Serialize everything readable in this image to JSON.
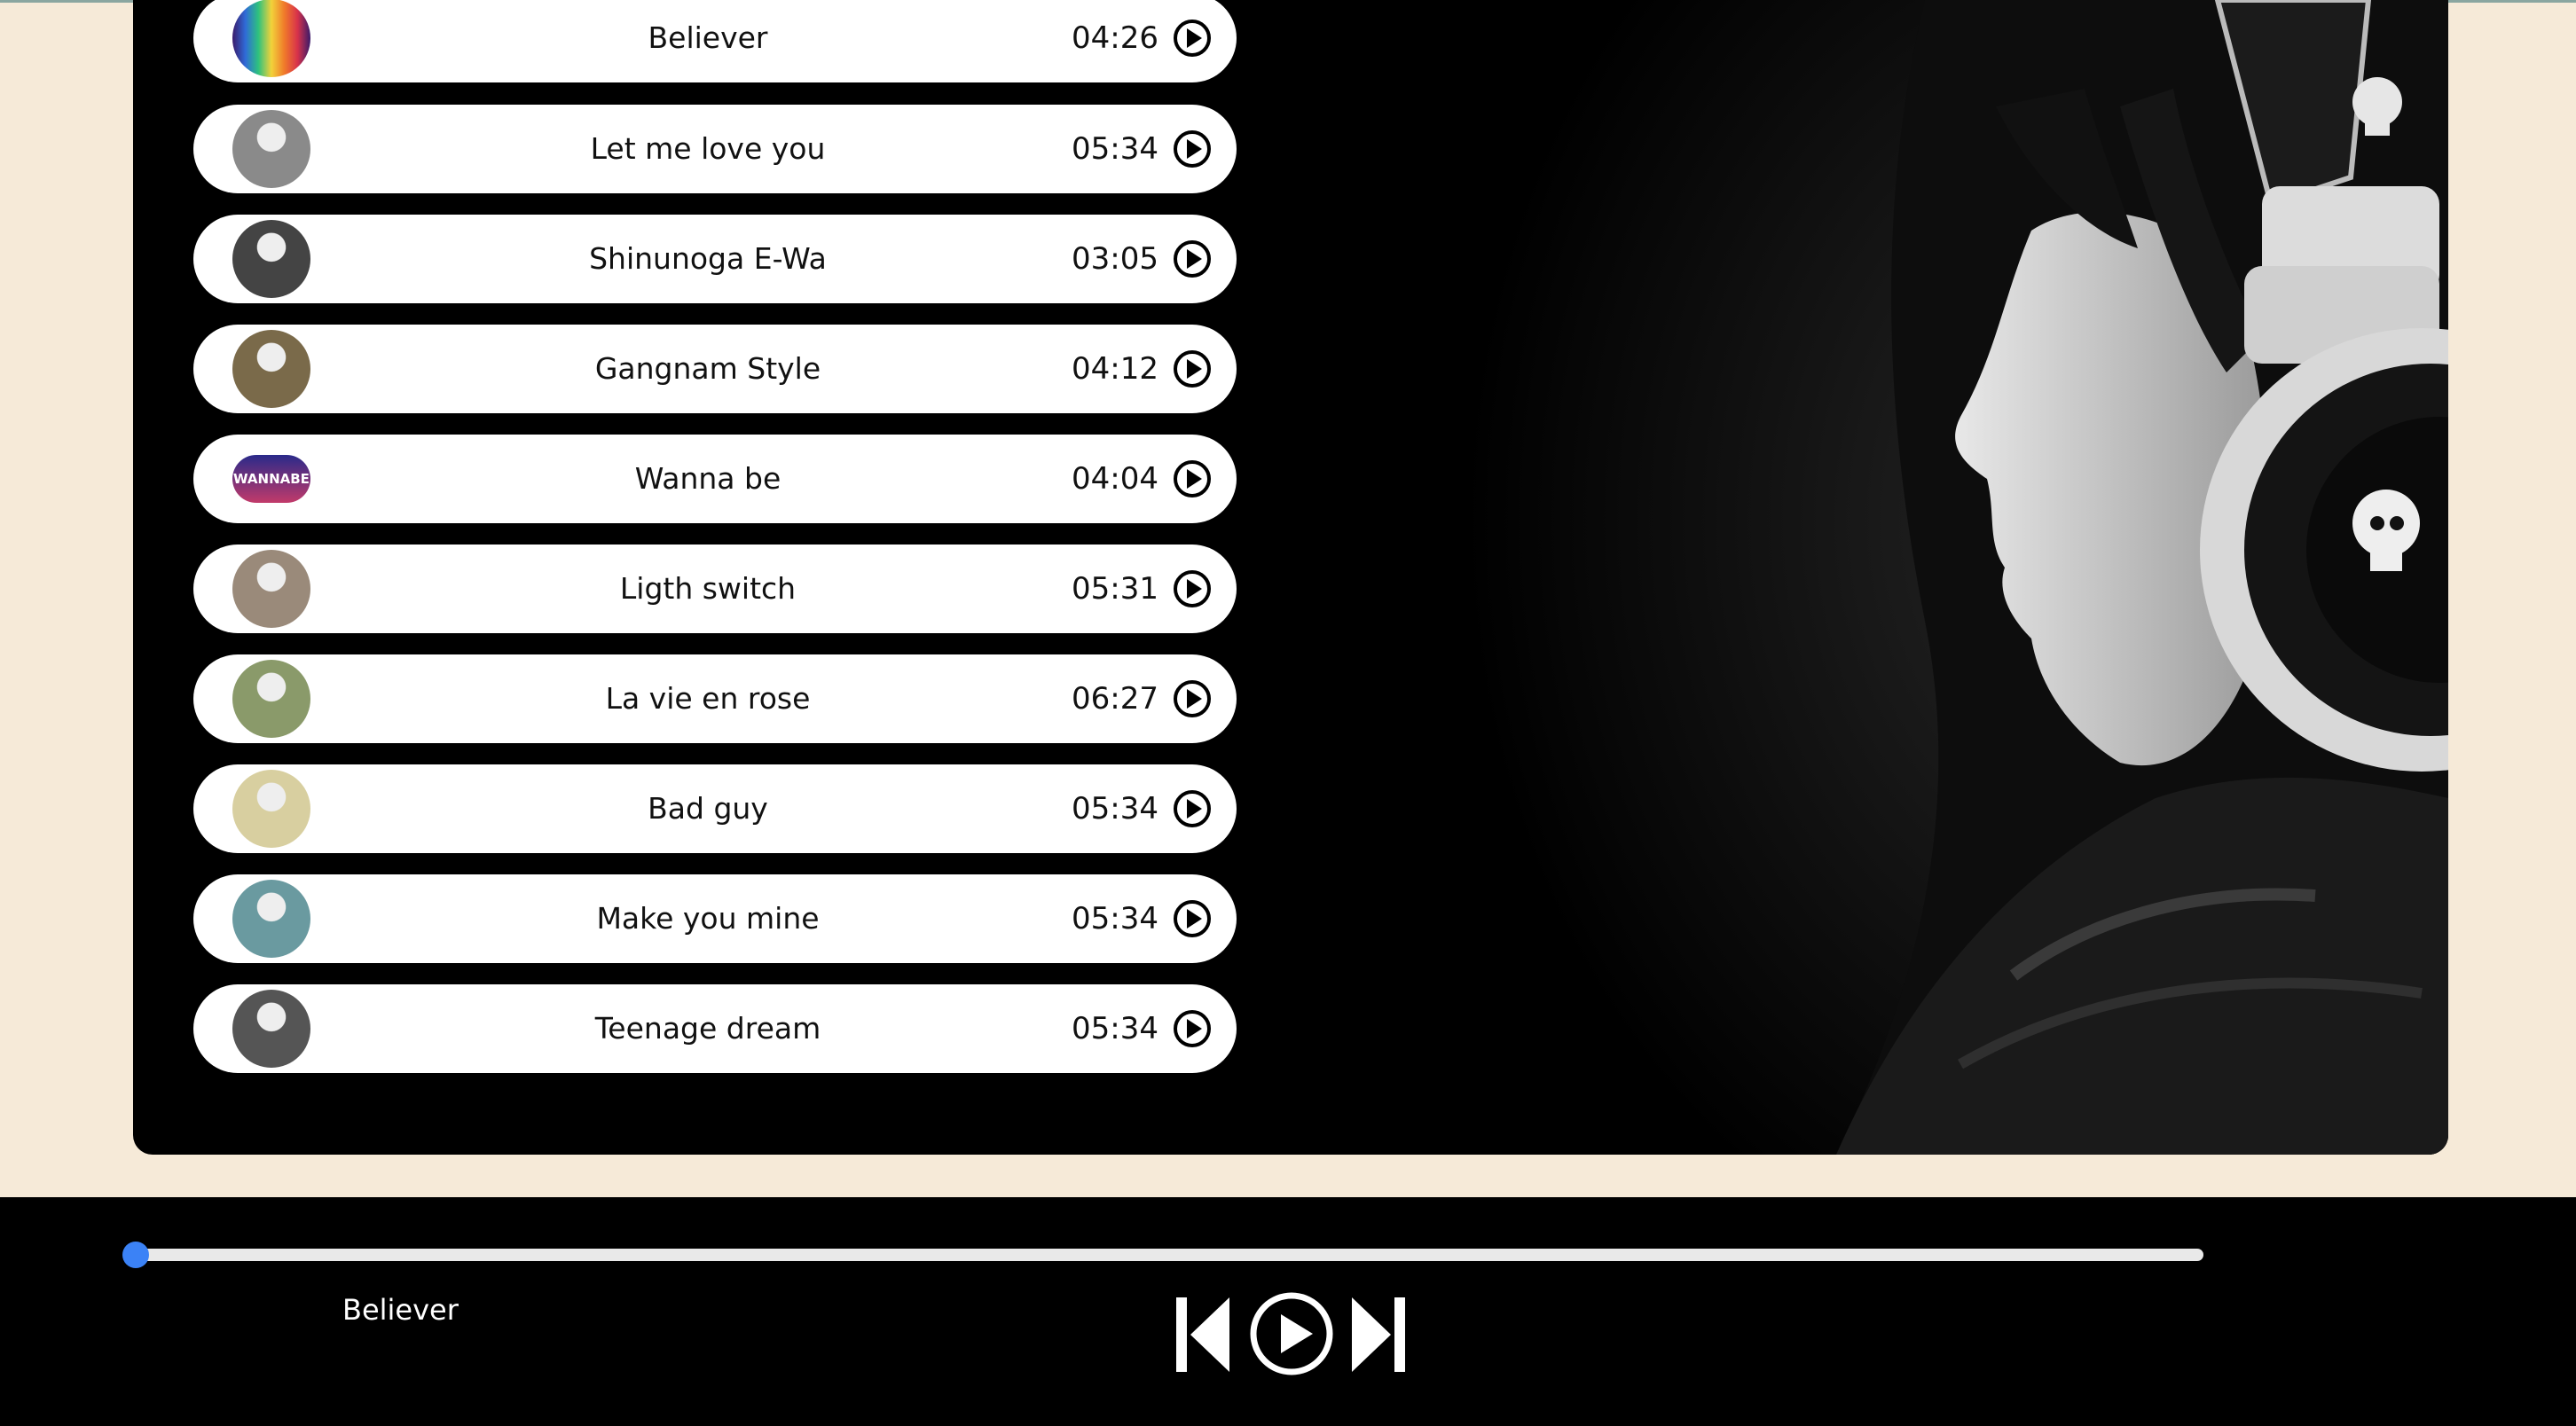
{
  "songs": [
    {
      "title": "Believer",
      "duration": "04:26",
      "thumb": "rainbow-cover"
    },
    {
      "title": "Let me love you",
      "duration": "05:34",
      "thumb": "artist-portrait"
    },
    {
      "title": "Shinunoga E-Wa",
      "duration": "03:05",
      "thumb": "artist-portrait"
    },
    {
      "title": "Gangnam Style",
      "duration": "04:12",
      "thumb": "artist-portrait"
    },
    {
      "title": "Wanna be",
      "duration": "04:04",
      "thumb": "wannabe-cover",
      "thumb_text": "WANNABE"
    },
    {
      "title": "Ligth switch",
      "duration": "05:31",
      "thumb": "artist-portrait"
    },
    {
      "title": "La vie en rose",
      "duration": "06:27",
      "thumb": "artist-portrait"
    },
    {
      "title": "Bad guy",
      "duration": "05:34",
      "thumb": "artist-portrait"
    },
    {
      "title": "Make you mine",
      "duration": "05:34",
      "thumb": "artist-portrait"
    },
    {
      "title": "Teenage dream",
      "duration": "05:34",
      "thumb": "artist-portrait"
    }
  ],
  "player": {
    "current_title": "Believer",
    "progress": 0.0
  },
  "colors": {
    "page_bg": "#f6ead8",
    "panel_bg": "#000000",
    "accent": "#3b82f6"
  }
}
